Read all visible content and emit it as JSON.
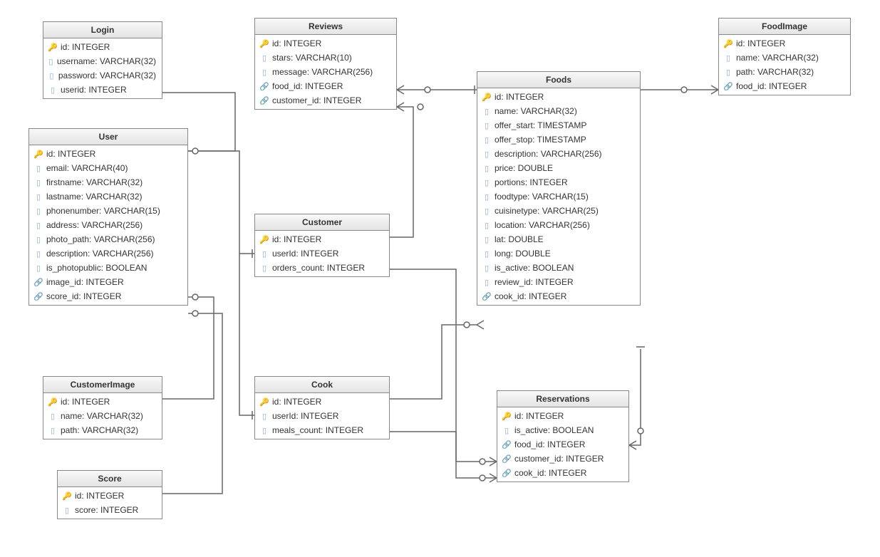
{
  "entities": {
    "login": {
      "title": "Login",
      "fields": [
        {
          "icon": "pk",
          "text": "id: INTEGER"
        },
        {
          "icon": "col",
          "text": "username: VARCHAR(32)"
        },
        {
          "icon": "col",
          "text": "password: VARCHAR(32)"
        },
        {
          "icon": "col",
          "text": "userid: INTEGER"
        }
      ]
    },
    "user": {
      "title": "User",
      "fields": [
        {
          "icon": "pk",
          "text": "id: INTEGER"
        },
        {
          "icon": "col",
          "text": "email: VARCHAR(40)"
        },
        {
          "icon": "col",
          "text": "firstname: VARCHAR(32)"
        },
        {
          "icon": "col",
          "text": "lastname: VARCHAR(32)"
        },
        {
          "icon": "col",
          "text": "phonenumber: VARCHAR(15)"
        },
        {
          "icon": "col",
          "text": "address: VARCHAR(256)"
        },
        {
          "icon": "col",
          "text": "photo_path: VARCHAR(256)"
        },
        {
          "icon": "col",
          "text": "description: VARCHAR(256)"
        },
        {
          "icon": "col",
          "text": "is_photopublic: BOOLEAN"
        },
        {
          "icon": "fk-red",
          "text": "image_id: INTEGER"
        },
        {
          "icon": "fk-red",
          "text": "score_id: INTEGER"
        }
      ]
    },
    "reviews": {
      "title": "Reviews",
      "fields": [
        {
          "icon": "pk",
          "text": "id: INTEGER"
        },
        {
          "icon": "col",
          "text": "stars: VARCHAR(10)"
        },
        {
          "icon": "col",
          "text": "message: VARCHAR(256)"
        },
        {
          "icon": "fk",
          "text": "food_id: INTEGER"
        },
        {
          "icon": "fk",
          "text": "customer_id: INTEGER"
        }
      ]
    },
    "customer": {
      "title": "Customer",
      "fields": [
        {
          "icon": "pk",
          "text": "id: INTEGER"
        },
        {
          "icon": "col",
          "text": "userId: INTEGER"
        },
        {
          "icon": "col",
          "text": "orders_count: INTEGER"
        }
      ]
    },
    "cook": {
      "title": "Cook",
      "fields": [
        {
          "icon": "pk",
          "text": "id: INTEGER"
        },
        {
          "icon": "col",
          "text": "userId: INTEGER"
        },
        {
          "icon": "col",
          "text": "meals_count: INTEGER"
        }
      ]
    },
    "customerImage": {
      "title": "CustomerImage",
      "fields": [
        {
          "icon": "pk",
          "text": "id: INTEGER"
        },
        {
          "icon": "col",
          "text": "name: VARCHAR(32)"
        },
        {
          "icon": "col",
          "text": "path: VARCHAR(32)"
        }
      ]
    },
    "score": {
      "title": "Score",
      "fields": [
        {
          "icon": "pk",
          "text": "id: INTEGER"
        },
        {
          "icon": "col",
          "text": "score: INTEGER"
        }
      ]
    },
    "foods": {
      "title": "Foods",
      "fields": [
        {
          "icon": "pk",
          "text": "id: INTEGER"
        },
        {
          "icon": "col",
          "text": "name: VARCHAR(32)"
        },
        {
          "icon": "col",
          "text": "offer_start: TIMESTAMP"
        },
        {
          "icon": "col",
          "text": "offer_stop: TIMESTAMP"
        },
        {
          "icon": "col",
          "text": "description: VARCHAR(256)"
        },
        {
          "icon": "col",
          "text": "price: DOUBLE"
        },
        {
          "icon": "col",
          "text": "portions: INTEGER"
        },
        {
          "icon": "col",
          "text": "foodtype: VARCHAR(15)"
        },
        {
          "icon": "col",
          "text": "cuisinetype: VARCHAR(25)"
        },
        {
          "icon": "col",
          "text": "location: VARCHAR(256)"
        },
        {
          "icon": "col",
          "text": "lat: DOUBLE"
        },
        {
          "icon": "col",
          "text": "long: DOUBLE"
        },
        {
          "icon": "col",
          "text": "is_active: BOOLEAN"
        },
        {
          "icon": "col",
          "text": "review_id: INTEGER"
        },
        {
          "icon": "fk",
          "text": "cook_id: INTEGER"
        }
      ]
    },
    "reservations": {
      "title": "Reservations",
      "fields": [
        {
          "icon": "pk",
          "text": "id: INTEGER"
        },
        {
          "icon": "col",
          "text": "is_active: BOOLEAN"
        },
        {
          "icon": "fk",
          "text": "food_id: INTEGER"
        },
        {
          "icon": "fk",
          "text": "customer_id: INTEGER"
        },
        {
          "icon": "fk",
          "text": "cook_id: INTEGER"
        }
      ]
    },
    "foodImage": {
      "title": "FoodImage",
      "fields": [
        {
          "icon": "pk",
          "text": "id: INTEGER"
        },
        {
          "icon": "col",
          "text": "name: VARCHAR(32)"
        },
        {
          "icon": "col",
          "text": "path: VARCHAR(32)"
        },
        {
          "icon": "fk",
          "text": "food_id: INTEGER"
        }
      ]
    }
  }
}
